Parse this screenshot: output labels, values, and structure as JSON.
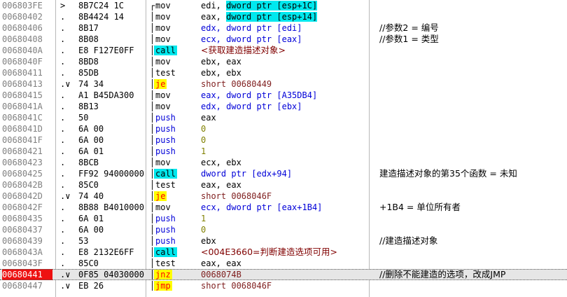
{
  "rows": [
    {
      "addr": "006803FE",
      "mark": ">",
      "bytes": "8B7C24 1C",
      "bracket": "┌",
      "mnemonic": "mov",
      "kind": "plain",
      "ops": [
        {
          "t": "edi, "
        },
        {
          "t": "dword ptr [esp+1C]",
          "s": "hl-op"
        }
      ],
      "comment": ""
    },
    {
      "addr": "00680402",
      "mark": ".",
      "bytes": "8B4424 14",
      "bracket": "│",
      "mnemonic": "mov",
      "kind": "plain",
      "ops": [
        {
          "t": "eax, "
        },
        {
          "t": "dword ptr [esp+14]",
          "s": "hl-op"
        }
      ],
      "comment": ""
    },
    {
      "addr": "00680406",
      "mark": ".",
      "bytes": "8B17",
      "bracket": "│",
      "mnemonic": "mov",
      "kind": "plain",
      "ops": [
        {
          "t": "edx, dword ptr [edi]",
          "s": "blue"
        }
      ],
      "comment": "//参数2 = 编号"
    },
    {
      "addr": "00680408",
      "mark": ".",
      "bytes": "8B08",
      "bracket": "│",
      "mnemonic": "mov",
      "kind": "plain",
      "ops": [
        {
          "t": "ecx, dword ptr [eax]",
          "s": "blue"
        }
      ],
      "comment": "//参数1 = 类型"
    },
    {
      "addr": "0068040A",
      "mark": ".",
      "bytes": "E8 F127E0FF",
      "bracket": "│",
      "mnemonic": "call",
      "kind": "call",
      "ops": [
        {
          "t": "<获取建造描述对象>",
          "s": "brace"
        }
      ],
      "comment": ""
    },
    {
      "addr": "0068040F",
      "mark": ".",
      "bytes": "8BD8",
      "bracket": "│",
      "mnemonic": "mov",
      "kind": "plain",
      "ops": [
        {
          "t": "ebx, eax"
        }
      ],
      "comment": ""
    },
    {
      "addr": "00680411",
      "mark": ".",
      "bytes": "85DB",
      "bracket": "│",
      "mnemonic": "test",
      "kind": "plain",
      "ops": [
        {
          "t": "ebx, ebx"
        }
      ],
      "comment": ""
    },
    {
      "addr": "00680413",
      "mark": ".∨",
      "bytes": "74 34",
      "bracket": "│",
      "mnemonic": "je",
      "kind": "jcc",
      "ops": [
        {
          "t": "short 00680449",
          "s": "br"
        }
      ],
      "comment": ""
    },
    {
      "addr": "00680415",
      "mark": ".",
      "bytes": "A1 B45DA300",
      "bracket": "│",
      "mnemonic": "mov",
      "kind": "plain",
      "ops": [
        {
          "t": "eax, dword ptr [A35DB4]",
          "s": "blue"
        }
      ],
      "comment": ""
    },
    {
      "addr": "0068041A",
      "mark": ".",
      "bytes": "8B13",
      "bracket": "│",
      "mnemonic": "mov",
      "kind": "plain",
      "ops": [
        {
          "t": "edx, dword ptr [ebx]",
          "s": "blue"
        }
      ],
      "comment": ""
    },
    {
      "addr": "0068041C",
      "mark": ".",
      "bytes": "50",
      "bracket": "│",
      "mnemonic": "push",
      "kind": "push",
      "ops": [
        {
          "t": "eax"
        }
      ],
      "comment": ""
    },
    {
      "addr": "0068041D",
      "mark": ".",
      "bytes": "6A 00",
      "bracket": "│",
      "mnemonic": "push",
      "kind": "push",
      "ops": [
        {
          "t": "0",
          "s": "num"
        }
      ],
      "comment": ""
    },
    {
      "addr": "0068041F",
      "mark": ".",
      "bytes": "6A 00",
      "bracket": "│",
      "mnemonic": "push",
      "kind": "push",
      "ops": [
        {
          "t": "0",
          "s": "num"
        }
      ],
      "comment": ""
    },
    {
      "addr": "00680421",
      "mark": ".",
      "bytes": "6A 01",
      "bracket": "│",
      "mnemonic": "push",
      "kind": "push",
      "ops": [
        {
          "t": "1",
          "s": "num"
        }
      ],
      "comment": ""
    },
    {
      "addr": "00680423",
      "mark": ".",
      "bytes": "8BCB",
      "bracket": "│",
      "mnemonic": "mov",
      "kind": "plain",
      "ops": [
        {
          "t": "ecx, ebx"
        }
      ],
      "comment": ""
    },
    {
      "addr": "00680425",
      "mark": ".",
      "bytes": "FF92 94000000",
      "bracket": "│",
      "mnemonic": "call",
      "kind": "call",
      "ops": [
        {
          "t": "dword ptr [edx+94]",
          "s": "blue"
        }
      ],
      "comment": "建造描述对象的第35个函数 = 未知"
    },
    {
      "addr": "0068042B",
      "mark": ".",
      "bytes": "85C0",
      "bracket": "│",
      "mnemonic": "test",
      "kind": "plain",
      "ops": [
        {
          "t": "eax, eax"
        }
      ],
      "comment": ""
    },
    {
      "addr": "0068042D",
      "mark": ".∨",
      "bytes": "74 40",
      "bracket": "│",
      "mnemonic": "je",
      "kind": "jcc",
      "ops": [
        {
          "t": "short 0068046F",
          "s": "br"
        }
      ],
      "comment": ""
    },
    {
      "addr": "0068042F",
      "mark": ".",
      "bytes": "8B88 B4010000",
      "bracket": "│",
      "mnemonic": "mov",
      "kind": "plain",
      "ops": [
        {
          "t": "ecx, dword ptr [eax+1B4]",
          "s": "blue"
        }
      ],
      "comment": "+1B4 = 单位所有者"
    },
    {
      "addr": "00680435",
      "mark": ".",
      "bytes": "6A 01",
      "bracket": "│",
      "mnemonic": "push",
      "kind": "push",
      "ops": [
        {
          "t": "1",
          "s": "num"
        }
      ],
      "comment": ""
    },
    {
      "addr": "00680437",
      "mark": ".",
      "bytes": "6A 00",
      "bracket": "│",
      "mnemonic": "push",
      "kind": "push",
      "ops": [
        {
          "t": "0",
          "s": "num"
        }
      ],
      "comment": ""
    },
    {
      "addr": "00680439",
      "mark": ".",
      "bytes": "53",
      "bracket": "│",
      "mnemonic": "push",
      "kind": "push",
      "ops": [
        {
          "t": "ebx"
        }
      ],
      "comment": "//建造描述对象"
    },
    {
      "addr": "0068043A",
      "mark": ".",
      "bytes": "E8 2132E6FF",
      "bracket": "│",
      "mnemonic": "call",
      "kind": "call",
      "ops": [
        {
          "t": "<004E3660=判断建造选项可用>",
          "s": "brace"
        }
      ],
      "comment": ""
    },
    {
      "addr": "0068043F",
      "mark": ".",
      "bytes": "85C0",
      "bracket": "│",
      "mnemonic": "test",
      "kind": "plain",
      "ops": [
        {
          "t": "eax, eax"
        }
      ],
      "comment": ""
    },
    {
      "addr": "00680441",
      "mark": ".∨",
      "bytes": "0F85 04030000",
      "bracket": "│",
      "mnemonic": "jnz",
      "kind": "jcc",
      "ops": [
        {
          "t": "0068074B",
          "s": "br"
        }
      ],
      "comment": "//删除不能建造的选项，改成JMP",
      "selected": true
    },
    {
      "addr": "00680447",
      "mark": ".∨",
      "bytes": "EB 26",
      "bracket": "│",
      "mnemonic": "jmp",
      "kind": "jcc",
      "ops": [
        {
          "t": "short 0068046F",
          "s": "br"
        }
      ],
      "comment": ""
    }
  ]
}
